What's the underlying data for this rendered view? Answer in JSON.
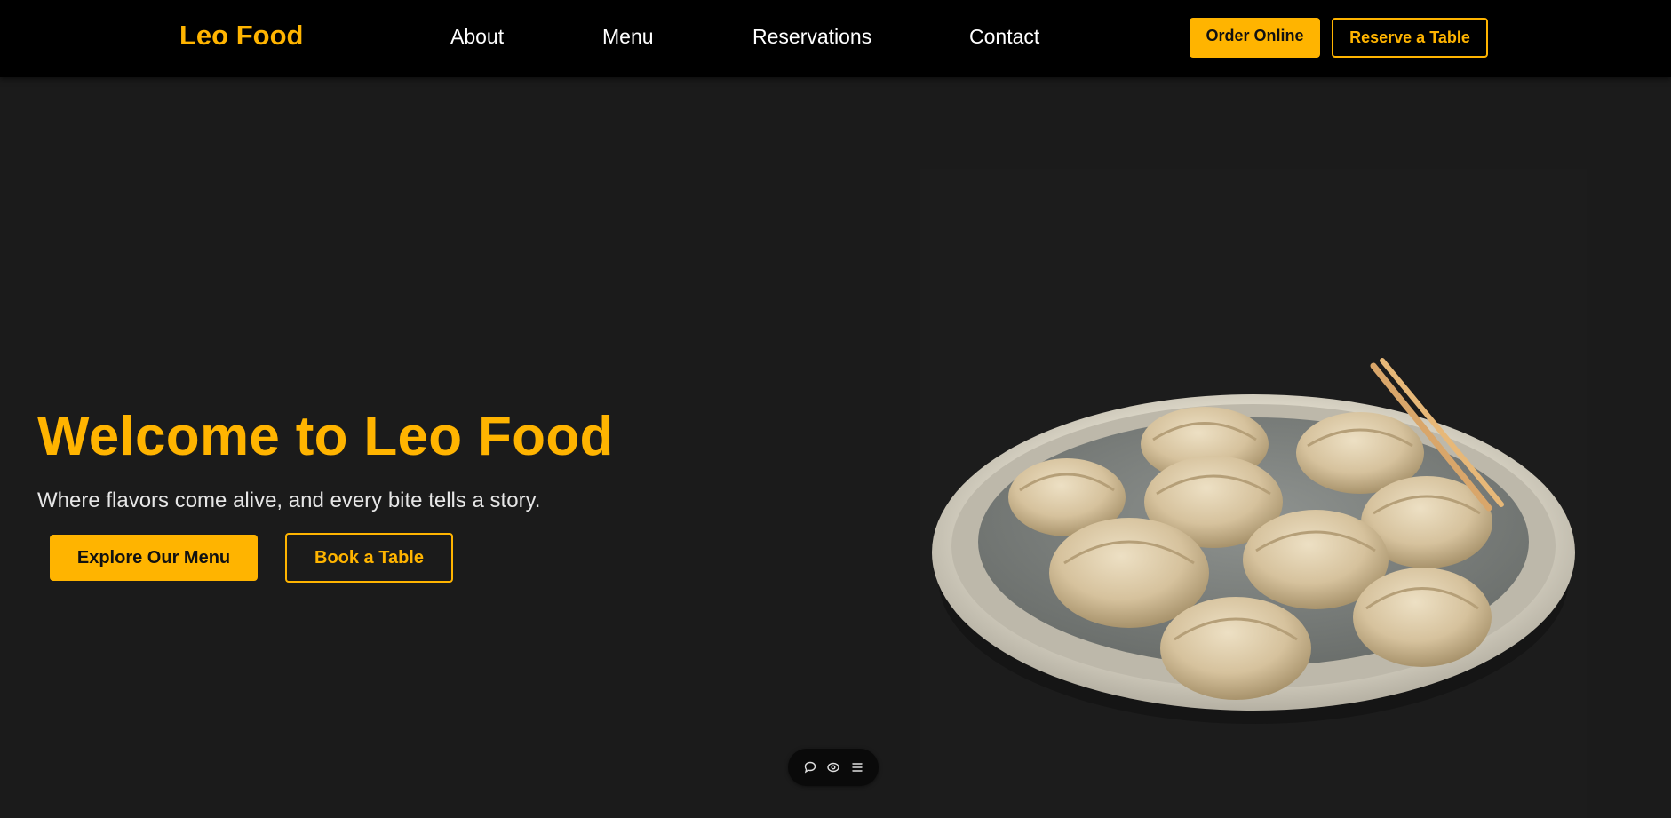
{
  "nav": {
    "logo": "Leo Food",
    "links": [
      {
        "label": "About"
      },
      {
        "label": "Menu"
      },
      {
        "label": "Reservations"
      },
      {
        "label": "Contact"
      }
    ],
    "order_button": "Order Online",
    "reserve_button": "Reserve a Table"
  },
  "hero": {
    "title": "Welcome to Leo Food",
    "subtitle": "Where flavors come alive, and every bite tells a story.",
    "primary_button": "Explore Our Menu",
    "secondary_button": "Book a Table",
    "image_icon": "dumplings-plate-image"
  },
  "toolbar": {
    "icons": [
      "comment-icon",
      "eye-icon",
      "menu-icon"
    ]
  },
  "colors": {
    "accent": "#ffb400",
    "navbar_bg": "#000000",
    "page_bg": "#1b1b1b",
    "text_light": "#ffffff"
  }
}
